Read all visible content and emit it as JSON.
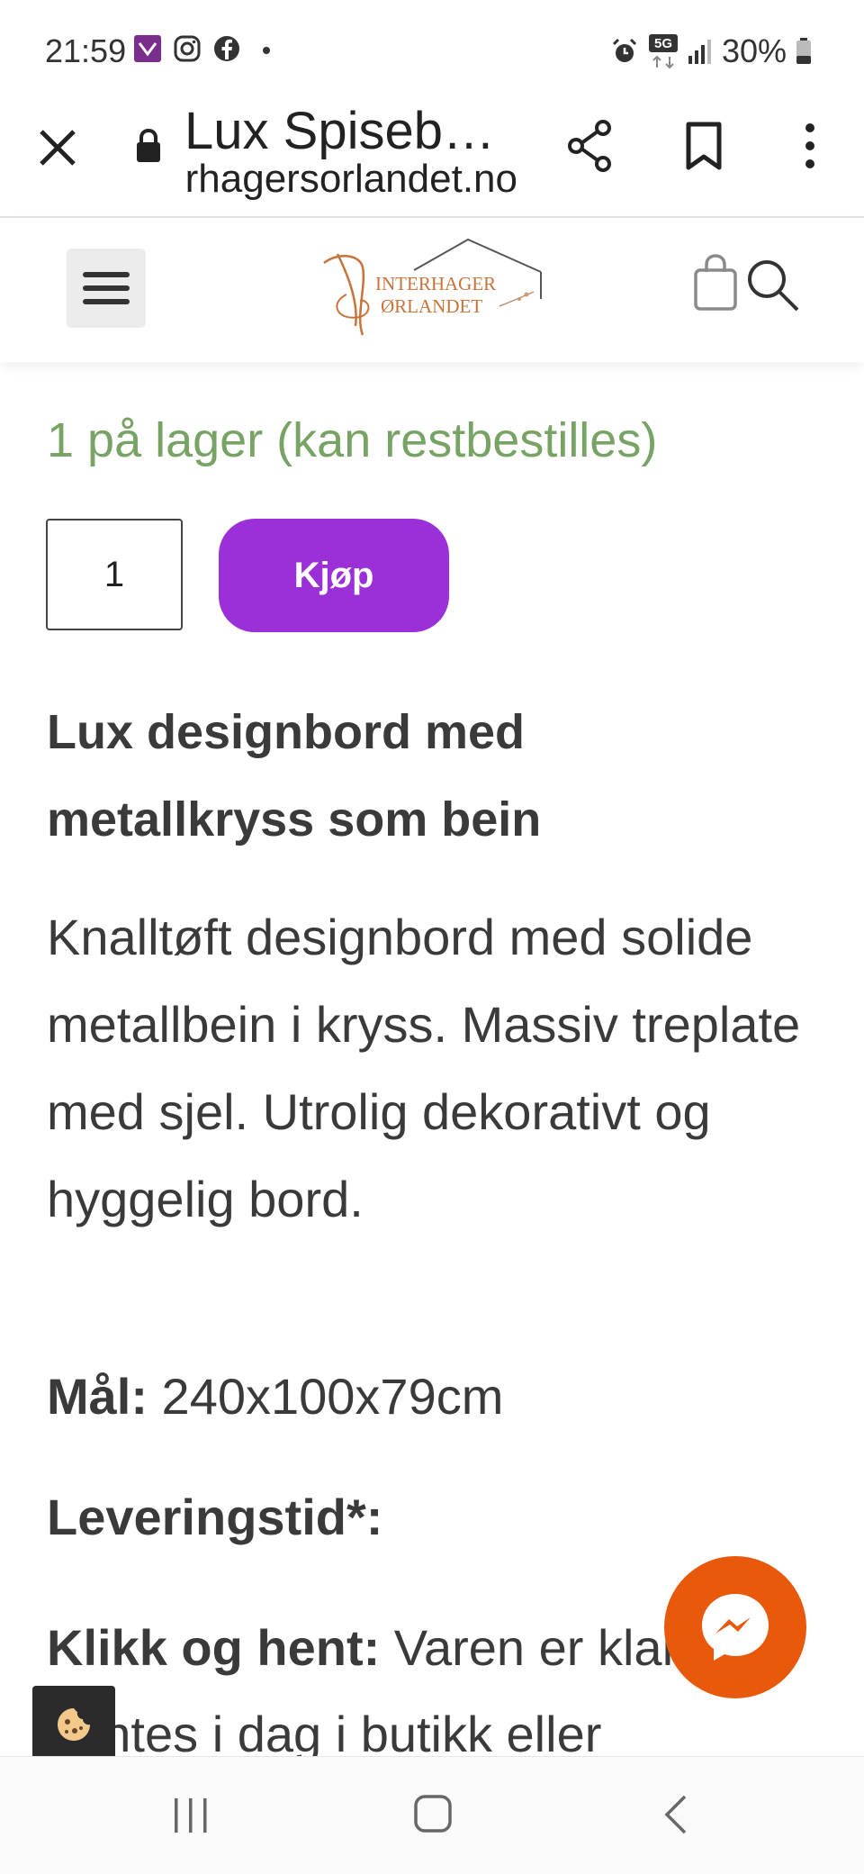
{
  "status_bar": {
    "time": "21:59",
    "left_icons": [
      "app-notification-icon",
      "instagram-icon",
      "facebook-icon",
      "dot-icon"
    ],
    "right_icons": [
      "alarm-icon",
      "5g-icon",
      "signal-icon"
    ],
    "network_label": "5G",
    "battery_text": "30%"
  },
  "browser": {
    "title": "Lux Spiseb…",
    "url": "vinterhagersorlandet.no",
    "icons": [
      "close-icon",
      "lock-icon",
      "share-icon",
      "bookmark-icon",
      "more-icon"
    ]
  },
  "site_header": {
    "logo_text_line1": "INTERHAGER",
    "logo_text_line2": "ØRLANDET",
    "icons": [
      "menu-icon",
      "cart-icon",
      "search-icon"
    ]
  },
  "product": {
    "stock_text": "1 på lager (kan restbestilles)",
    "quantity": "1",
    "buy_label": "Kjøp",
    "heading": "Lux designbord med metallkryss som bein",
    "description": "Knalltøft designbord med solide metallbein i kryss. Massiv treplate med sjel. Utrolig dekorativt og hyggelig bord.",
    "measure_label": "Mål:",
    "measure_value": " 240x100x79cm",
    "delivery_label": "Leveringstid*:",
    "pickup_label": "Klikk og hent:",
    "pickup_text": " Varen er klar til å hentes i dag i butikk eller"
  },
  "colors": {
    "stock_green": "#77a464",
    "buy_purple": "#9b30d9",
    "messenger_orange": "#e8590c",
    "text_dark": "#3a3a3a"
  },
  "widgets": [
    "messenger-icon",
    "cookie-icon"
  ],
  "nav_bar": [
    "recent-apps-icon",
    "home-icon",
    "back-icon"
  ]
}
